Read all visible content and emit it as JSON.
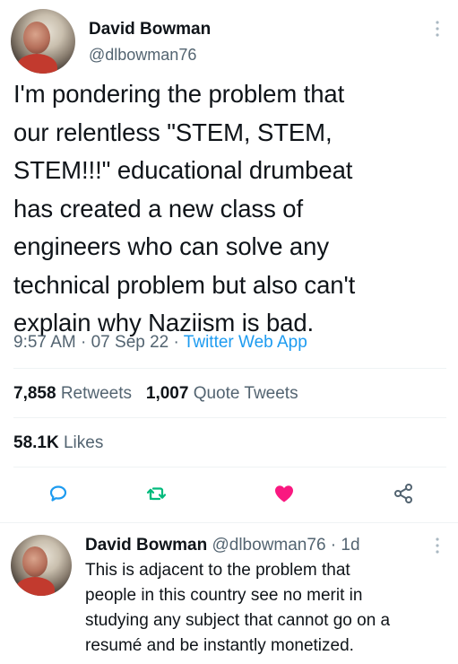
{
  "tweet": {
    "author_name": "David Bowman",
    "author_handle": "@dlbowman76",
    "text": "I'm pondering the problem that\nour relentless \"STEM, STEM,\nSTEM!!!\" educational drumbeat\nhas created a new class of\nengineers who can solve any\ntechnical problem but also can't\nexplain why Naziism is bad.",
    "time": "9:57 AM",
    "date": "07 Sep 22",
    "source": "Twitter Web App",
    "separator": "·"
  },
  "stats": {
    "retweets_count": "7,858",
    "retweets_label": "Retweets",
    "quote_count": "1,007",
    "quote_label": "Quote Tweets",
    "likes_count": "58.1K",
    "likes_label": "Likes"
  },
  "actions": {
    "reply_icon": "reply-icon",
    "retweet_icon": "retweet-icon",
    "like_icon": "heart-icon",
    "share_icon": "share-icon",
    "like_color": "#f91880",
    "retweet_color": "#00ba7c",
    "reply_color": "#1d9bf0"
  },
  "reply": {
    "author_name": "David Bowman",
    "author_handle": "@dlbowman76",
    "time_ago": "· 1d",
    "text": "This is adjacent to the problem that\npeople in this country see no merit in\nstudying any subject that cannot go on a\nresumé and be instantly monetized."
  }
}
